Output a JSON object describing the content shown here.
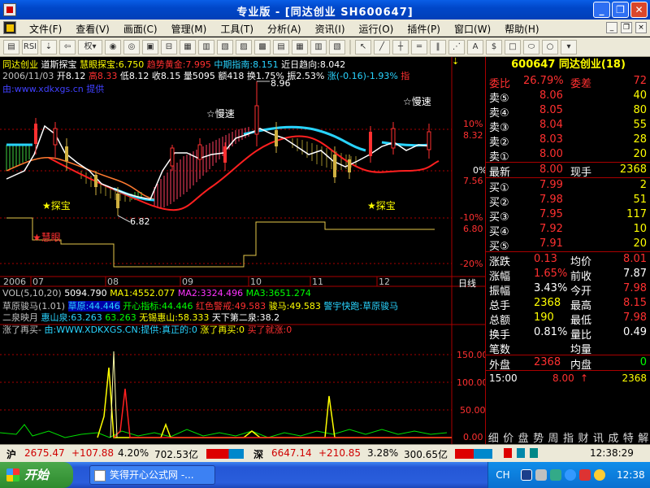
{
  "window": {
    "title": "专业版 - [同达创业 SH600647]",
    "minimize": "_",
    "restore": "❐",
    "close": "✕"
  },
  "menu": {
    "items": [
      "文件(F)",
      "查看(V)",
      "画面(C)",
      "管理(M)",
      "工具(T)",
      "分析(A)",
      "资讯(I)",
      "运行(O)",
      "插件(P)",
      "窗口(W)",
      "帮助(H)"
    ]
  },
  "toolbar": {
    "icons": [
      "folder-icon",
      "rsi-icon",
      "down-arrow-icon",
      "back-arrow-icon",
      "quan-select",
      "magnet-icon",
      "cycle-icon",
      "camera-icon",
      "minus-box-icon",
      "chart-f1-icon",
      "chart-f2-icon",
      "chart-f3-icon",
      "chart-f4-icon",
      "chart-f5-icon",
      "chart-f6-icon",
      "chart-f7-icon",
      "chart-f8-icon",
      "chart-f9-icon",
      "cursor-icon",
      "line-tool-icon",
      "cross-tool-icon",
      "hline-icon",
      "grid-icon",
      "fan-icon",
      "text-icon",
      "dollar-icon",
      "rect-icon",
      "ellipse-icon",
      "circle-icon",
      "menu-arrow-icon"
    ],
    "quan_label": "权"
  },
  "main": {
    "info1": {
      "name": "同达创业",
      "indicator": "道斯探宝",
      "huiyan": "慧眼探宝:6.750",
      "qushi": "趋势黄金:7.995",
      "zhongqi": "中期指南:8.151",
      "jinri": "近日趋向:8.042"
    },
    "info2": {
      "date": "2006/11/03",
      "open": "开8.12",
      "high": "高8.33",
      "low": "低8.12",
      "close": "收8.15",
      "vol": "量5095",
      "amount": "额418",
      "turnover": "换1.75%",
      "amp": "振2.53%",
      "chg": "涨(-0.16)-1.93%",
      "tail": "指"
    },
    "info3": "由:www.xdkxgs.cn 提供",
    "main_chart": {
      "annotations": {
        "top_price": "8.96",
        "low_price": "6.82",
        "man_left": "☆慢速",
        "man_right": "☆慢速",
        "tanbao_left": "★探宝",
        "tanbao_right": "★探宝",
        "huiyan": "★慧眼"
      },
      "axis": {
        "p10": "10%",
        "price1": "8.32",
        "p0": "0%",
        "price2": "7.56",
        "m10": "-10%",
        "price3": "6.80",
        "m20": "-20%"
      },
      "dates": [
        "2006",
        "07",
        "08",
        "09",
        "10",
        "11",
        "12",
        "日线"
      ]
    },
    "vol_line": {
      "label": "VOL(5,10,20)",
      "v1": "5094.790",
      "ma1": "MA1:4552.077",
      "ma2": "MA2:3324.496",
      "ma3": "MA3:3651.274"
    },
    "line2": {
      "name": "草原骏马(1.01)",
      "a": "草原:44.446",
      "b": "开心指标:44.446",
      "c": "红色警戒:49.583",
      "d": "骏马:49.583",
      "e": "警宇快跑:草原骏马"
    },
    "line3": {
      "name": "二泉映月",
      "a": "惠山泉:63.263",
      "b": "63.263",
      "c": "无锡惠山:58.333",
      "d": "天下第二泉:38.2"
    },
    "line4": {
      "name": "涨了再买-",
      "a": "由:WWW.XDKXGS.CN:提供:真正的:0",
      "b": "涨了再买:0",
      "c": "买了就涨:0"
    },
    "sub_axis": [
      "150.00",
      "100.00",
      "50.00",
      "0.00"
    ]
  },
  "panel": {
    "code": "600647 同达创业(18)",
    "weibi": {
      "l": "委比",
      "v": "26.79%",
      "l2": "委差",
      "v2": "72"
    },
    "sells": [
      {
        "l": "卖⑤",
        "p": "8.06",
        "q": "40"
      },
      {
        "l": "卖④",
        "p": "8.05",
        "q": "80"
      },
      {
        "l": "卖③",
        "p": "8.04",
        "q": "55"
      },
      {
        "l": "卖②",
        "p": "8.03",
        "q": "28"
      },
      {
        "l": "卖①",
        "p": "8.00",
        "q": "20"
      }
    ],
    "latest": {
      "l": "最新",
      "p": "8.00",
      "l2": "现手",
      "q": "2368"
    },
    "buys": [
      {
        "l": "买①",
        "p": "7.99",
        "q": "2"
      },
      {
        "l": "买②",
        "p": "7.98",
        "q": "51"
      },
      {
        "l": "买③",
        "p": "7.95",
        "q": "117"
      },
      {
        "l": "买④",
        "p": "7.92",
        "q": "10"
      },
      {
        "l": "买⑤",
        "p": "7.91",
        "q": "20"
      }
    ],
    "stats": [
      {
        "l": "涨跌",
        "v": "0.13",
        "l2": "均价",
        "v2": "8.01"
      },
      {
        "l": "涨幅",
        "v": "1.65%",
        "l2": "前收",
        "v2": "7.87"
      },
      {
        "l": "振幅",
        "v": "3.43%",
        "l2": "今开",
        "v2": "7.98"
      },
      {
        "l": "总手",
        "v": "2368",
        "l2": "最高",
        "v2": "8.15"
      },
      {
        "l": "总额",
        "v": "190",
        "l2": "最低",
        "v2": "7.98"
      },
      {
        "l": "换手",
        "v": "0.81%",
        "l2": "量比",
        "v2": "0.49"
      },
      {
        "l": "笔数",
        "v": "",
        "l2": "均量",
        "v2": ""
      },
      {
        "l": "外盘",
        "v": "2368",
        "l2": "内盘",
        "v2": "0"
      }
    ],
    "tick": {
      "time": "15:00",
      "price": "8.00",
      "arrow": "↑",
      "vol": "2368"
    },
    "tabs": [
      "细",
      "价",
      "盘",
      "势",
      "周",
      "指",
      "财",
      "讯",
      "成",
      "特",
      "解"
    ]
  },
  "status": {
    "sh_label": "沪",
    "sh_val": "2675.47",
    "sh_chg": "+107.88",
    "sh_pct": "4.20%",
    "sh_amt": "702.53亿",
    "sz_label": "深",
    "sz_val": "6647.14",
    "sz_chg": "+210.85",
    "sz_pct": "3.28%",
    "sz_amt": "300.65亿",
    "time": "12:38:29"
  },
  "taskbar": {
    "start": "开始",
    "task": "笑得开心公式网 -...",
    "lang": "CH",
    "clock": "12:38"
  }
}
